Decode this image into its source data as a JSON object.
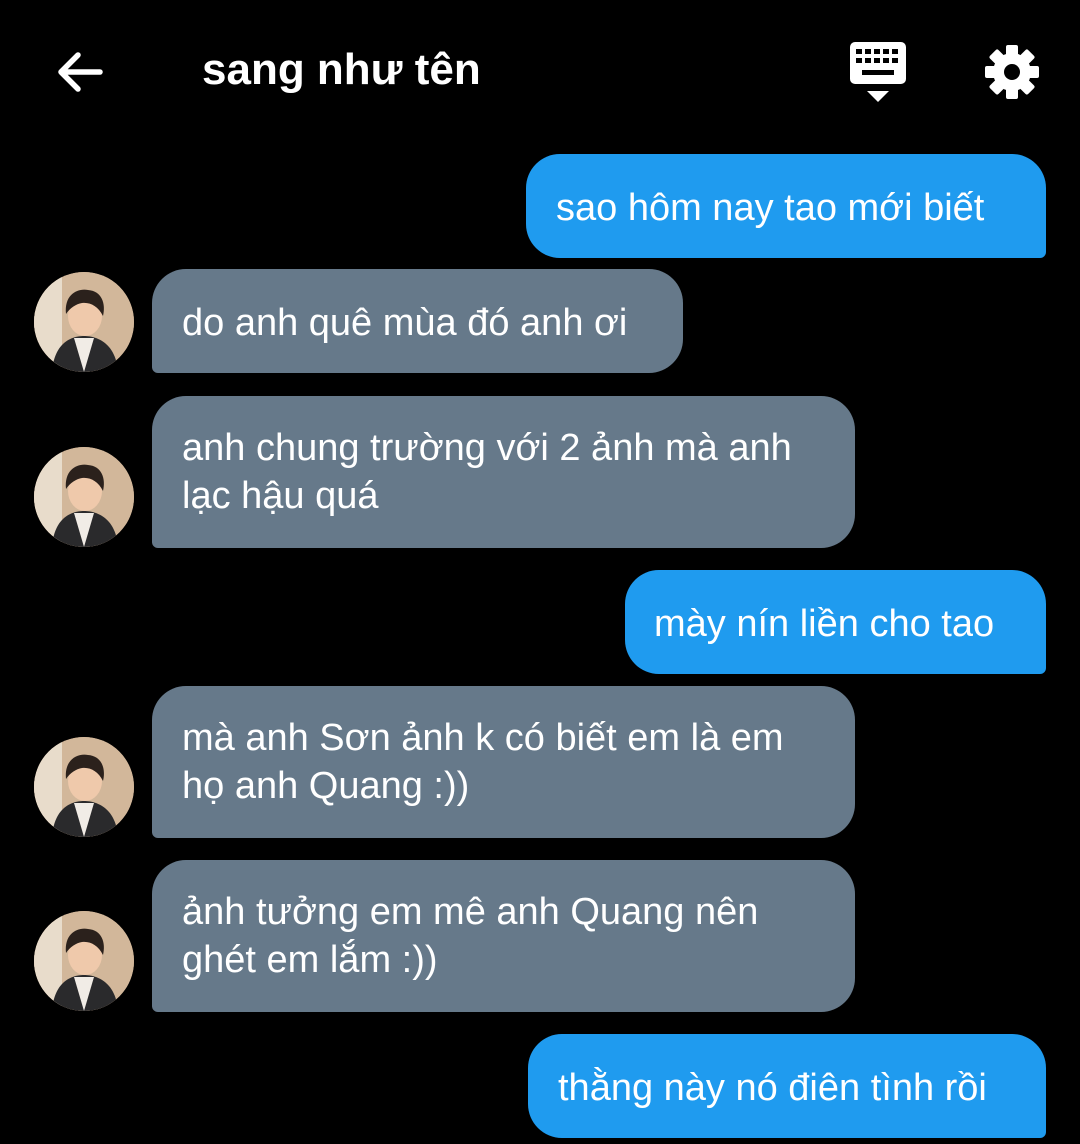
{
  "header": {
    "back_icon": "arrow-left-icon",
    "title": "sang như tên",
    "keyboard_icon": "keyboard-icon",
    "settings_icon": "gear-icon"
  },
  "colors": {
    "background": "#000000",
    "outgoing_bubble": "#1f9bef",
    "incoming_bubble": "#66798a",
    "text": "#ffffff"
  },
  "messages": [
    {
      "direction": "out",
      "lines": [
        "sao hôm nay tao mới biết"
      ]
    },
    {
      "direction": "in",
      "lines": [
        "do anh quê mùa đó anh ơi"
      ]
    },
    {
      "direction": "in",
      "lines": [
        "anh chung trường với 2 ảnh mà anh",
        "lạc hậu quá"
      ]
    },
    {
      "direction": "out",
      "lines": [
        "mày nín liền cho tao"
      ]
    },
    {
      "direction": "in",
      "lines": [
        "mà anh Sơn ảnh k có biết em là em",
        "họ anh Quang :))"
      ]
    },
    {
      "direction": "in",
      "lines": [
        "ảnh tưởng em mê anh Quang nên",
        "ghét em lắm :))"
      ]
    },
    {
      "direction": "out",
      "lines": [
        "thằng này nó điên tình rồi"
      ]
    }
  ]
}
